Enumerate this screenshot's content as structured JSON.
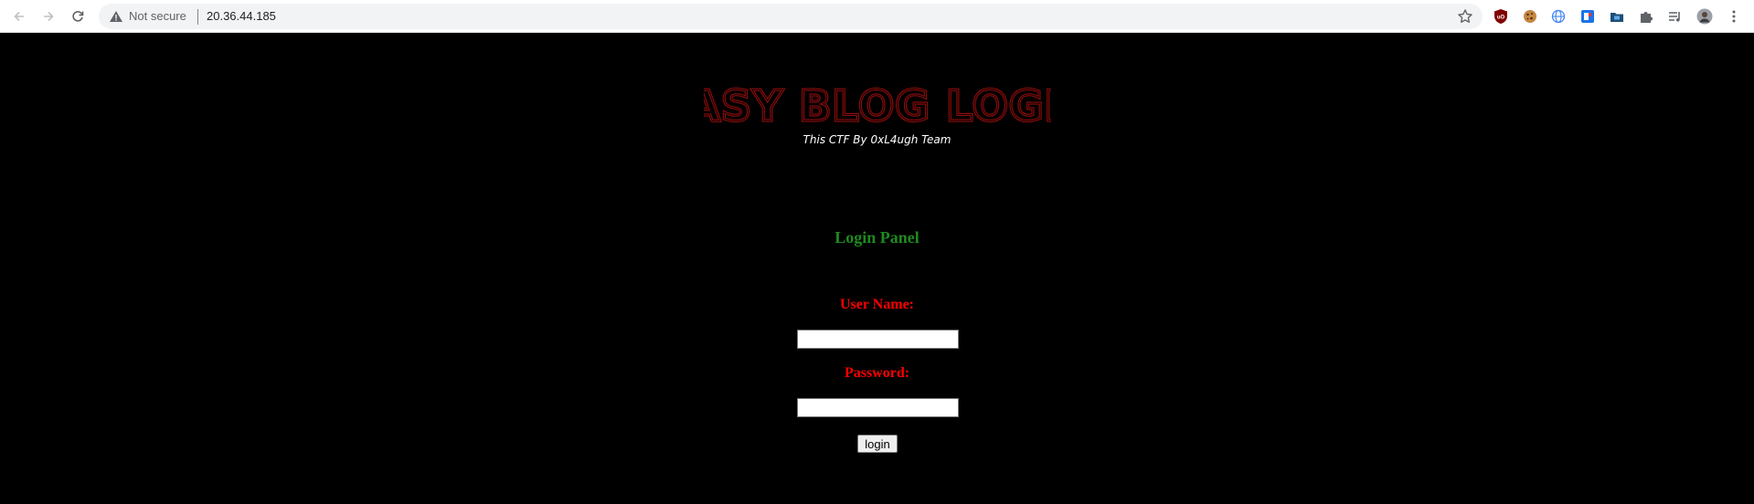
{
  "browser": {
    "security_status": "Not secure",
    "url": "20.36.44.185",
    "icons": {
      "back": "arrow-left-icon",
      "forward": "arrow-right-icon",
      "reload": "reload-icon",
      "warning": "warning-triangle-icon",
      "bookmark": "star-icon"
    },
    "extensions": [
      {
        "name": "ublock-origin-icon",
        "color": "#800000"
      },
      {
        "name": "cookie-icon",
        "color": "#b5651d"
      },
      {
        "name": "translate-globe-icon",
        "color": "#4285f4"
      },
      {
        "name": "pocket-icon",
        "color": "#1a73e8"
      },
      {
        "name": "video-folder-icon",
        "color": "#1f4e79"
      },
      {
        "name": "puzzle-extensions-icon",
        "color": "#5f6368"
      },
      {
        "name": "media-queue-icon",
        "color": "#5f6368"
      },
      {
        "name": "profile-avatar-icon",
        "color": "#7a6a5a"
      },
      {
        "name": "kebab-menu-icon",
        "color": "#5f6368"
      }
    ]
  },
  "page": {
    "logo_text": "EASY BLOG LOGIN",
    "subtitle": "This CTF By 0xL4ugh Team",
    "panel_title": "Login Panel",
    "username_label": "User Name:",
    "username_value": "",
    "password_label": "Password:",
    "password_value": "",
    "login_button": "login",
    "colors": {
      "background": "#000000",
      "logo": "#8b0c0c",
      "panel_title": "#1f8a1f",
      "labels": "#ff0000",
      "subtitle": "#ffffff"
    }
  }
}
